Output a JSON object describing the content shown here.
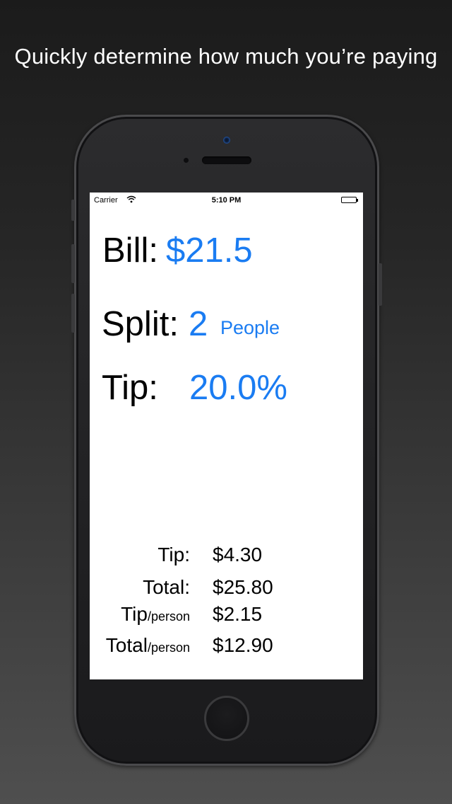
{
  "headline": "Quickly determine how much you’re paying",
  "status_bar": {
    "carrier": "Carrier",
    "time": "5:10 PM"
  },
  "inputs": {
    "bill_label": "Bill:",
    "bill_value": "$21.5",
    "split_label": "Split:",
    "split_value": "2",
    "split_unit": "People",
    "tip_label": "Tip:",
    "tip_value": "20.0%"
  },
  "summary": {
    "tip_label": "Tip:",
    "tip_value": "$4.30",
    "total_label": "Total:",
    "total_value": "$25.80",
    "tip_person_label": "Tip",
    "tip_person_suffix": "/person",
    "tip_person_value": "$2.15",
    "total_person_label": "Total",
    "total_person_suffix": "/person",
    "total_person_value": "$12.90"
  },
  "colors": {
    "accent": "#1a7cf2",
    "screen_background": "#ffffff"
  }
}
